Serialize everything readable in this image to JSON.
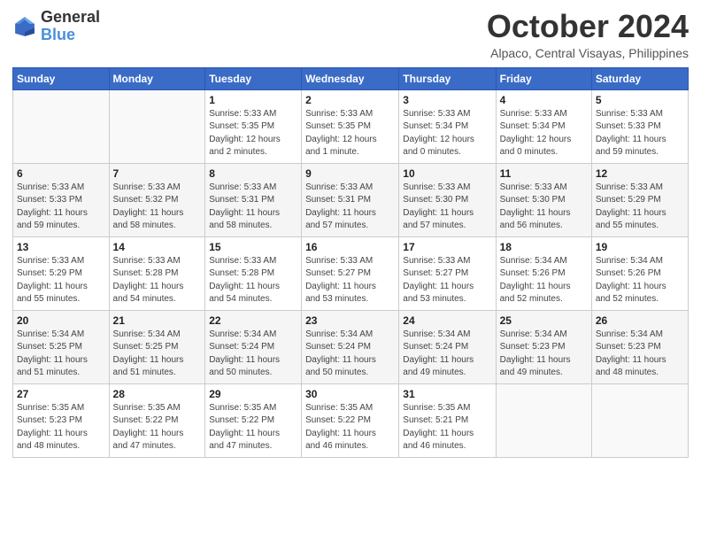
{
  "header": {
    "logo_general": "General",
    "logo_blue": "Blue",
    "title": "October 2024",
    "location": "Alpaco, Central Visayas, Philippines"
  },
  "days_of_week": [
    "Sunday",
    "Monday",
    "Tuesday",
    "Wednesday",
    "Thursday",
    "Friday",
    "Saturday"
  ],
  "weeks": [
    [
      {
        "day": "",
        "info": ""
      },
      {
        "day": "",
        "info": ""
      },
      {
        "day": "1",
        "info": "Sunrise: 5:33 AM\nSunset: 5:35 PM\nDaylight: 12 hours\nand 2 minutes."
      },
      {
        "day": "2",
        "info": "Sunrise: 5:33 AM\nSunset: 5:35 PM\nDaylight: 12 hours\nand 1 minute."
      },
      {
        "day": "3",
        "info": "Sunrise: 5:33 AM\nSunset: 5:34 PM\nDaylight: 12 hours\nand 0 minutes."
      },
      {
        "day": "4",
        "info": "Sunrise: 5:33 AM\nSunset: 5:34 PM\nDaylight: 12 hours\nand 0 minutes."
      },
      {
        "day": "5",
        "info": "Sunrise: 5:33 AM\nSunset: 5:33 PM\nDaylight: 11 hours\nand 59 minutes."
      }
    ],
    [
      {
        "day": "6",
        "info": "Sunrise: 5:33 AM\nSunset: 5:33 PM\nDaylight: 11 hours\nand 59 minutes."
      },
      {
        "day": "7",
        "info": "Sunrise: 5:33 AM\nSunset: 5:32 PM\nDaylight: 11 hours\nand 58 minutes."
      },
      {
        "day": "8",
        "info": "Sunrise: 5:33 AM\nSunset: 5:31 PM\nDaylight: 11 hours\nand 58 minutes."
      },
      {
        "day": "9",
        "info": "Sunrise: 5:33 AM\nSunset: 5:31 PM\nDaylight: 11 hours\nand 57 minutes."
      },
      {
        "day": "10",
        "info": "Sunrise: 5:33 AM\nSunset: 5:30 PM\nDaylight: 11 hours\nand 57 minutes."
      },
      {
        "day": "11",
        "info": "Sunrise: 5:33 AM\nSunset: 5:30 PM\nDaylight: 11 hours\nand 56 minutes."
      },
      {
        "day": "12",
        "info": "Sunrise: 5:33 AM\nSunset: 5:29 PM\nDaylight: 11 hours\nand 55 minutes."
      }
    ],
    [
      {
        "day": "13",
        "info": "Sunrise: 5:33 AM\nSunset: 5:29 PM\nDaylight: 11 hours\nand 55 minutes."
      },
      {
        "day": "14",
        "info": "Sunrise: 5:33 AM\nSunset: 5:28 PM\nDaylight: 11 hours\nand 54 minutes."
      },
      {
        "day": "15",
        "info": "Sunrise: 5:33 AM\nSunset: 5:28 PM\nDaylight: 11 hours\nand 54 minutes."
      },
      {
        "day": "16",
        "info": "Sunrise: 5:33 AM\nSunset: 5:27 PM\nDaylight: 11 hours\nand 53 minutes."
      },
      {
        "day": "17",
        "info": "Sunrise: 5:33 AM\nSunset: 5:27 PM\nDaylight: 11 hours\nand 53 minutes."
      },
      {
        "day": "18",
        "info": "Sunrise: 5:34 AM\nSunset: 5:26 PM\nDaylight: 11 hours\nand 52 minutes."
      },
      {
        "day": "19",
        "info": "Sunrise: 5:34 AM\nSunset: 5:26 PM\nDaylight: 11 hours\nand 52 minutes."
      }
    ],
    [
      {
        "day": "20",
        "info": "Sunrise: 5:34 AM\nSunset: 5:25 PM\nDaylight: 11 hours\nand 51 minutes."
      },
      {
        "day": "21",
        "info": "Sunrise: 5:34 AM\nSunset: 5:25 PM\nDaylight: 11 hours\nand 51 minutes."
      },
      {
        "day": "22",
        "info": "Sunrise: 5:34 AM\nSunset: 5:24 PM\nDaylight: 11 hours\nand 50 minutes."
      },
      {
        "day": "23",
        "info": "Sunrise: 5:34 AM\nSunset: 5:24 PM\nDaylight: 11 hours\nand 50 minutes."
      },
      {
        "day": "24",
        "info": "Sunrise: 5:34 AM\nSunset: 5:24 PM\nDaylight: 11 hours\nand 49 minutes."
      },
      {
        "day": "25",
        "info": "Sunrise: 5:34 AM\nSunset: 5:23 PM\nDaylight: 11 hours\nand 49 minutes."
      },
      {
        "day": "26",
        "info": "Sunrise: 5:34 AM\nSunset: 5:23 PM\nDaylight: 11 hours\nand 48 minutes."
      }
    ],
    [
      {
        "day": "27",
        "info": "Sunrise: 5:35 AM\nSunset: 5:23 PM\nDaylight: 11 hours\nand 48 minutes."
      },
      {
        "day": "28",
        "info": "Sunrise: 5:35 AM\nSunset: 5:22 PM\nDaylight: 11 hours\nand 47 minutes."
      },
      {
        "day": "29",
        "info": "Sunrise: 5:35 AM\nSunset: 5:22 PM\nDaylight: 11 hours\nand 47 minutes."
      },
      {
        "day": "30",
        "info": "Sunrise: 5:35 AM\nSunset: 5:22 PM\nDaylight: 11 hours\nand 46 minutes."
      },
      {
        "day": "31",
        "info": "Sunrise: 5:35 AM\nSunset: 5:21 PM\nDaylight: 11 hours\nand 46 minutes."
      },
      {
        "day": "",
        "info": ""
      },
      {
        "day": "",
        "info": ""
      }
    ]
  ]
}
